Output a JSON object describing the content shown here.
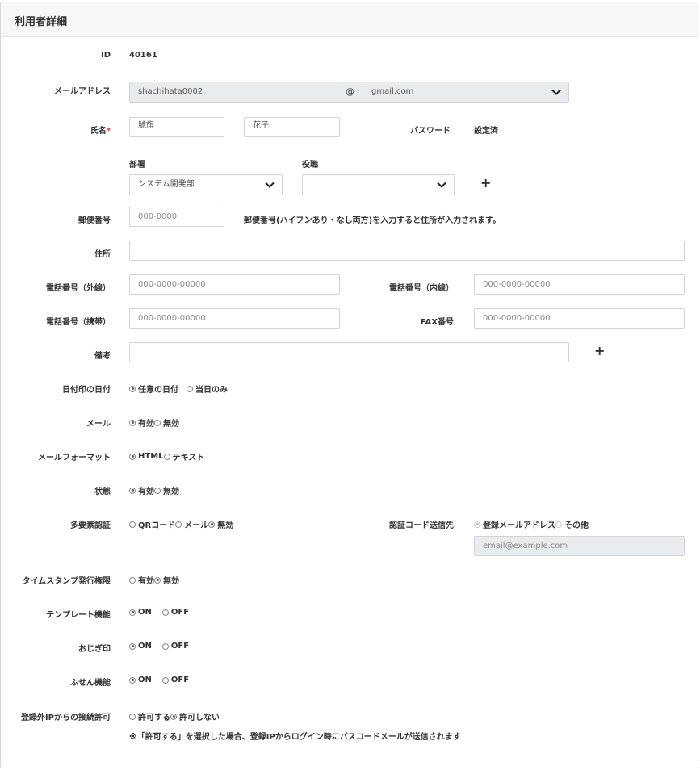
{
  "header": {
    "title": "利用者詳細"
  },
  "fields": {
    "id": {
      "label": "ID",
      "value": "40161"
    },
    "email": {
      "label": "メールアドレス",
      "local": "shachihata0002",
      "at": "@",
      "domain": "gmail.com"
    },
    "name": {
      "label": "氏名",
      "required_mark": "*",
      "last": "鯱旗",
      "first": "花子"
    },
    "password": {
      "label": "パスワード",
      "value": "設定済"
    },
    "department": {
      "label": "部署",
      "value": "システム開発部"
    },
    "position": {
      "label": "役職",
      "value": ""
    },
    "add_symbol": "+",
    "postal": {
      "label": "郵便番号",
      "placeholder": "000-0000",
      "hint": "郵便番号(ハイフンあり・なし両方)を入力すると住所が入力されます。"
    },
    "address": {
      "label": "住所",
      "value": ""
    },
    "phone_ext": {
      "label": "電話番号（外線）",
      "placeholder": "000-0000-00000"
    },
    "phone_int": {
      "label": "電話番号（内線）",
      "placeholder": "000-0000-00000"
    },
    "phone_mobile": {
      "label": "電話番号（携帯）",
      "placeholder": "000-0000-00000"
    },
    "fax": {
      "label": "FAX番号",
      "placeholder": "000-0000-00000"
    },
    "memo": {
      "label": "備考",
      "value": ""
    }
  },
  "radios": {
    "stamp_date": {
      "label": "日付印の日付",
      "options": [
        "任意の日付",
        "当日のみ"
      ],
      "selected": 0
    },
    "mail": {
      "label": "メール",
      "options": [
        "有効",
        "無効"
      ],
      "selected": 0
    },
    "mail_format": {
      "label": "メールフォーマット",
      "options": [
        "HTML",
        "テキスト"
      ],
      "selected": 0
    },
    "status": {
      "label": "状態",
      "options": [
        "有効",
        "無効"
      ],
      "selected": 0
    },
    "mfa": {
      "label": "多要素認証",
      "options": [
        "QRコード",
        "メール",
        "無効"
      ],
      "selected": 2
    },
    "auth_dest": {
      "label": "認証コード送信先",
      "options": [
        "登録メールアドレス",
        "その他"
      ],
      "selected": 0,
      "email_placeholder": "email@example.com"
    },
    "timestamp": {
      "label": "タイムスタンプ発行権限",
      "options": [
        "有効",
        "無効"
      ],
      "selected": 1
    },
    "template": {
      "label": "テンプレート機能",
      "options": [
        "ON",
        "OFF"
      ],
      "selected": 0
    },
    "ojigi": {
      "label": "おじぎ印",
      "options": [
        "ON",
        "OFF"
      ],
      "selected": 0
    },
    "sticky": {
      "label": "ふせん機能",
      "options": [
        "ON",
        "OFF"
      ],
      "selected": 0
    },
    "external_ip": {
      "label": "登録外IPからの接続許可",
      "options": [
        "許可する",
        "許可しない"
      ],
      "selected": 1,
      "note": "※「許可する」を選択した場合、登録IPからログイン時にパスコードメールが送信されます"
    }
  }
}
